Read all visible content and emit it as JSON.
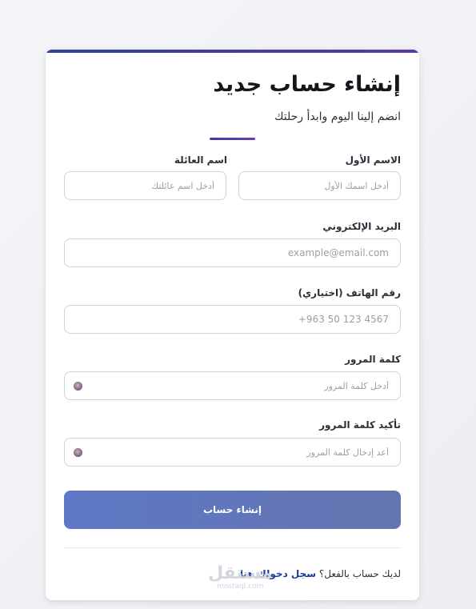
{
  "form": {
    "title": "إنشاء حساب جديد",
    "subtitle": "انضم إلينا اليوم وابدأ رحلتك",
    "first_name": {
      "label": "الاسم الأول",
      "placeholder": "أدخل اسمك الأول"
    },
    "last_name": {
      "label": "اسم العائلة",
      "placeholder": "أدخل اسم عائلتك"
    },
    "email": {
      "label": "البريد الإلكتروني",
      "placeholder": "example@email.com"
    },
    "phone": {
      "label": "رقم الهاتف (اختياري)",
      "placeholder": "+963 50 123 4567"
    },
    "password": {
      "label": "كلمة المرور",
      "placeholder": "أدخل كلمة المرور"
    },
    "confirm_password": {
      "label": "تأكيد كلمة المرور",
      "placeholder": "أعد إدخال كلمة المرور"
    },
    "submit_label": "إنشاء حساب",
    "footer_text": "لديك حساب بالفعل؟",
    "footer_link": "سجل دخولك هنا"
  },
  "watermark": {
    "logo": "مستقل",
    "sub": "mostaql.com"
  },
  "icons": {
    "password_toggle": "eye-icon",
    "confirm_toggle": "eye-icon"
  },
  "colors": {
    "accent": "#3a3fa8",
    "button": "#6376b0",
    "link": "#1a3b9c"
  }
}
